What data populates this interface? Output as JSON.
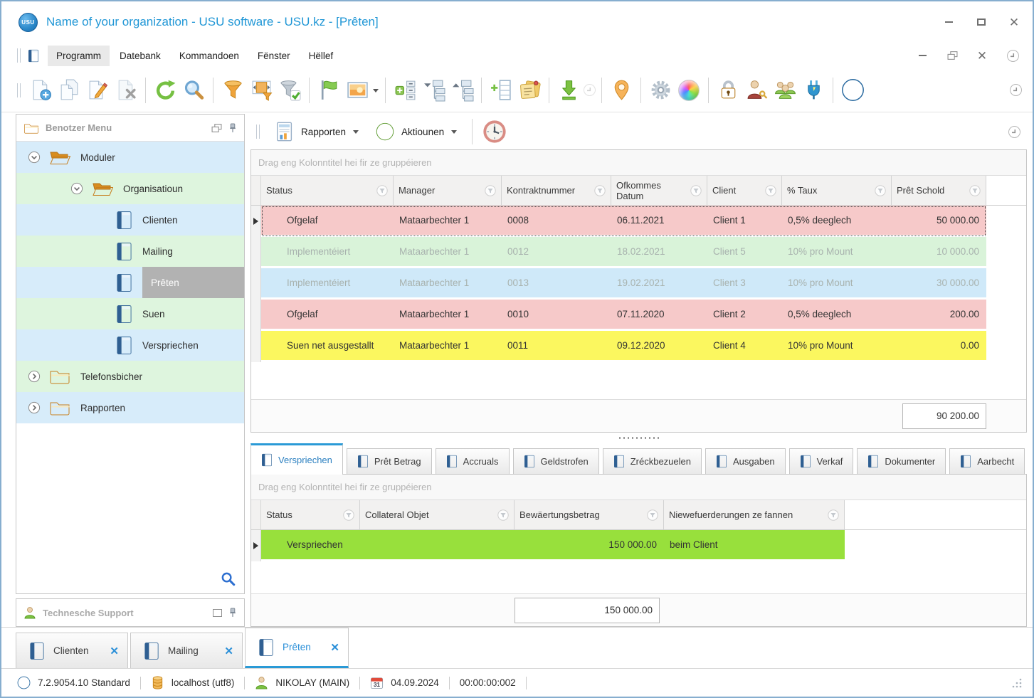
{
  "window": {
    "title": "Name of your organization - USU software - USU.kz - [Prêten]",
    "logo": "USU"
  },
  "menu": {
    "items": [
      "Programm",
      "Datebank",
      "Kommandoen",
      "Fënster",
      "Hëllef"
    ]
  },
  "icons": {
    "new-document": "page-with-plus",
    "copy-document": "two-pages",
    "edit-document": "page-with-pencil",
    "delete-document": "page-with-cross",
    "refresh": "green-circular-arrow",
    "search": "magnifier",
    "filter": "orange-funnel",
    "filter-custom": "funnel-with-range",
    "filter-apply": "funnel-with-check",
    "flag": "green-flag",
    "image": "picture-sunset",
    "expand-nodes": "tree-plus-list",
    "collapse-down": "org-chart-down",
    "collapse-up": "org-chart-up",
    "add-record": "table-with-plus",
    "notes": "sticky-notes-with-pin",
    "export": "green-down-arrow",
    "quick-menu": "circled-arrow",
    "location": "orange-map-pin",
    "settings": "gear",
    "appearance": "color-wheel",
    "security": "padlock",
    "user-rights": "user-with-key",
    "users": "user-group",
    "plugin": "blue-plug",
    "about": "info-circle",
    "reports": "report-document",
    "actions": "green-circle-arrow",
    "scheduler": "clock",
    "book": "blue-book",
    "folder": "orange-folder",
    "pin": "push-pin",
    "float": "overlapping-windows",
    "tree-search": "blue-magnifier",
    "support": "person",
    "version": "info-circle",
    "database": "orange-cylinder",
    "user": "green-person",
    "calendar": "calendar-31"
  },
  "sidebar": {
    "title": "Benotzer Menu",
    "tree": [
      {
        "label": "Moduler"
      },
      {
        "label": "Organisatioun"
      },
      {
        "label": "Clienten"
      },
      {
        "label": "Mailing"
      },
      {
        "label": "Prêten"
      },
      {
        "label": "Suen"
      },
      {
        "label": "Verspriechen"
      },
      {
        "label": "Telefonsbicher"
      },
      {
        "label": "Rapporten"
      }
    ],
    "support": {
      "title": "Technesche Support"
    }
  },
  "actions_bar": {
    "reports": "Rapporten",
    "actions": "Aktiounen"
  },
  "main_table": {
    "group_hint": "Drag eng Kolonntitel hei fir ze gruppéieren",
    "columns": [
      "Status",
      "Manager",
      "Kontraktnummer",
      "Ofkommes Datum",
      "Client",
      "% Taux",
      "Prêt Schold"
    ],
    "rows": [
      {
        "status": "Ofgelaf",
        "manager": "Mataarbechter 1",
        "kontrakt": "0008",
        "datum": "06.11.2021",
        "client": "Client 1",
        "taux": "0,5% deeglech",
        "schold": "50 000.00"
      },
      {
        "status": "Implementéiert",
        "manager": "Mataarbechter 1",
        "kontrakt": "0012",
        "datum": "18.02.2021",
        "client": "Client 5",
        "taux": "10% pro Mount",
        "schold": "10 000.00"
      },
      {
        "status": "Implementéiert",
        "manager": "Mataarbechter 1",
        "kontrakt": "0013",
        "datum": "19.02.2021",
        "client": "Client 3",
        "taux": "10% pro Mount",
        "schold": "30 000.00"
      },
      {
        "status": "Ofgelaf",
        "manager": "Mataarbechter 1",
        "kontrakt": "0010",
        "datum": "07.11.2020",
        "client": "Client 2",
        "taux": "0,5% deeglech",
        "schold": "200.00"
      },
      {
        "status": "Suen net ausgestallt",
        "manager": "Mataarbechter 1",
        "kontrakt": "0011",
        "datum": "09.12.2020",
        "client": "Client 4",
        "taux": "10% pro Mount",
        "schold": "0.00"
      }
    ],
    "total": "90 200.00"
  },
  "detail_tabs": [
    {
      "label": "Verspriechen"
    },
    {
      "label": "Prêt Betrag"
    },
    {
      "label": "Accruals"
    },
    {
      "label": "Geldstrofen"
    },
    {
      "label": "Zréckbezuelen"
    },
    {
      "label": "Ausgaben"
    },
    {
      "label": "Verkaf"
    },
    {
      "label": "Dokumenter"
    },
    {
      "label": "Aarbecht"
    }
  ],
  "detail_table": {
    "group_hint": "Drag eng Kolonntitel hei fir ze gruppéieren",
    "columns": [
      "Status",
      "Collateral Objet",
      "Bewäertungsbetrag",
      "Niewefuerderungen ze fannen"
    ],
    "rows": [
      {
        "status": "Verspriechen",
        "collateral": "",
        "betrag": "150 000.00",
        "niewefuerderungen": "beim Client"
      }
    ],
    "total": "150 000.00"
  },
  "window_tabs": [
    {
      "label": "Clienten"
    },
    {
      "label": "Mailing"
    },
    {
      "label": "Prêten"
    }
  ],
  "status_bar": {
    "version": "7.2.9054.10 Standard",
    "database": "localhost (utf8)",
    "user": "NIKOLAY (MAIN)",
    "date": "04.09.2024",
    "timer": "00:00:00:002"
  },
  "colors": {
    "accent_blue": "#2197d6",
    "row_ofgelaf": "#f6c9c9",
    "row_implementeiert_green": "#d9f3d9",
    "row_implementeiert_blue": "#cfe9f9",
    "row_suen_net_ausgestallt": "#fbf75f",
    "row_verspriechen_lime": "#98e03c",
    "tree_row_blue": "#d7ecfa",
    "tree_row_green": "#def5de",
    "selection_gray": "#b2b2b2"
  }
}
